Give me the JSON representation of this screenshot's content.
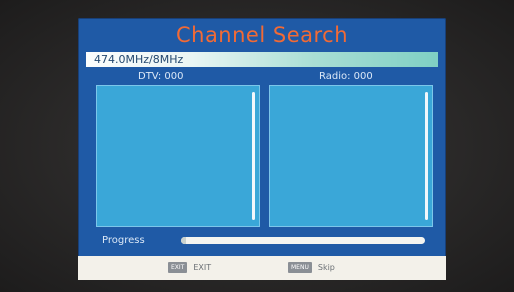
{
  "screen": {
    "title": "Channel Search",
    "frequency": "474.0MHz/8MHz",
    "dtv_label": "DTV: 000",
    "radio_label": "Radio: 000",
    "progress_label": "Progress",
    "progress_fraction": 0.02
  },
  "footer": {
    "exit_key": "EXIT",
    "exit_label": "EXIT",
    "skip_key": "MENU",
    "skip_label": "Skip"
  },
  "colors": {
    "osd_background": "#1f5aa6",
    "title": "#f26a35",
    "list_background": "#3aa7d8",
    "footer_background": "#f3f1ea"
  }
}
